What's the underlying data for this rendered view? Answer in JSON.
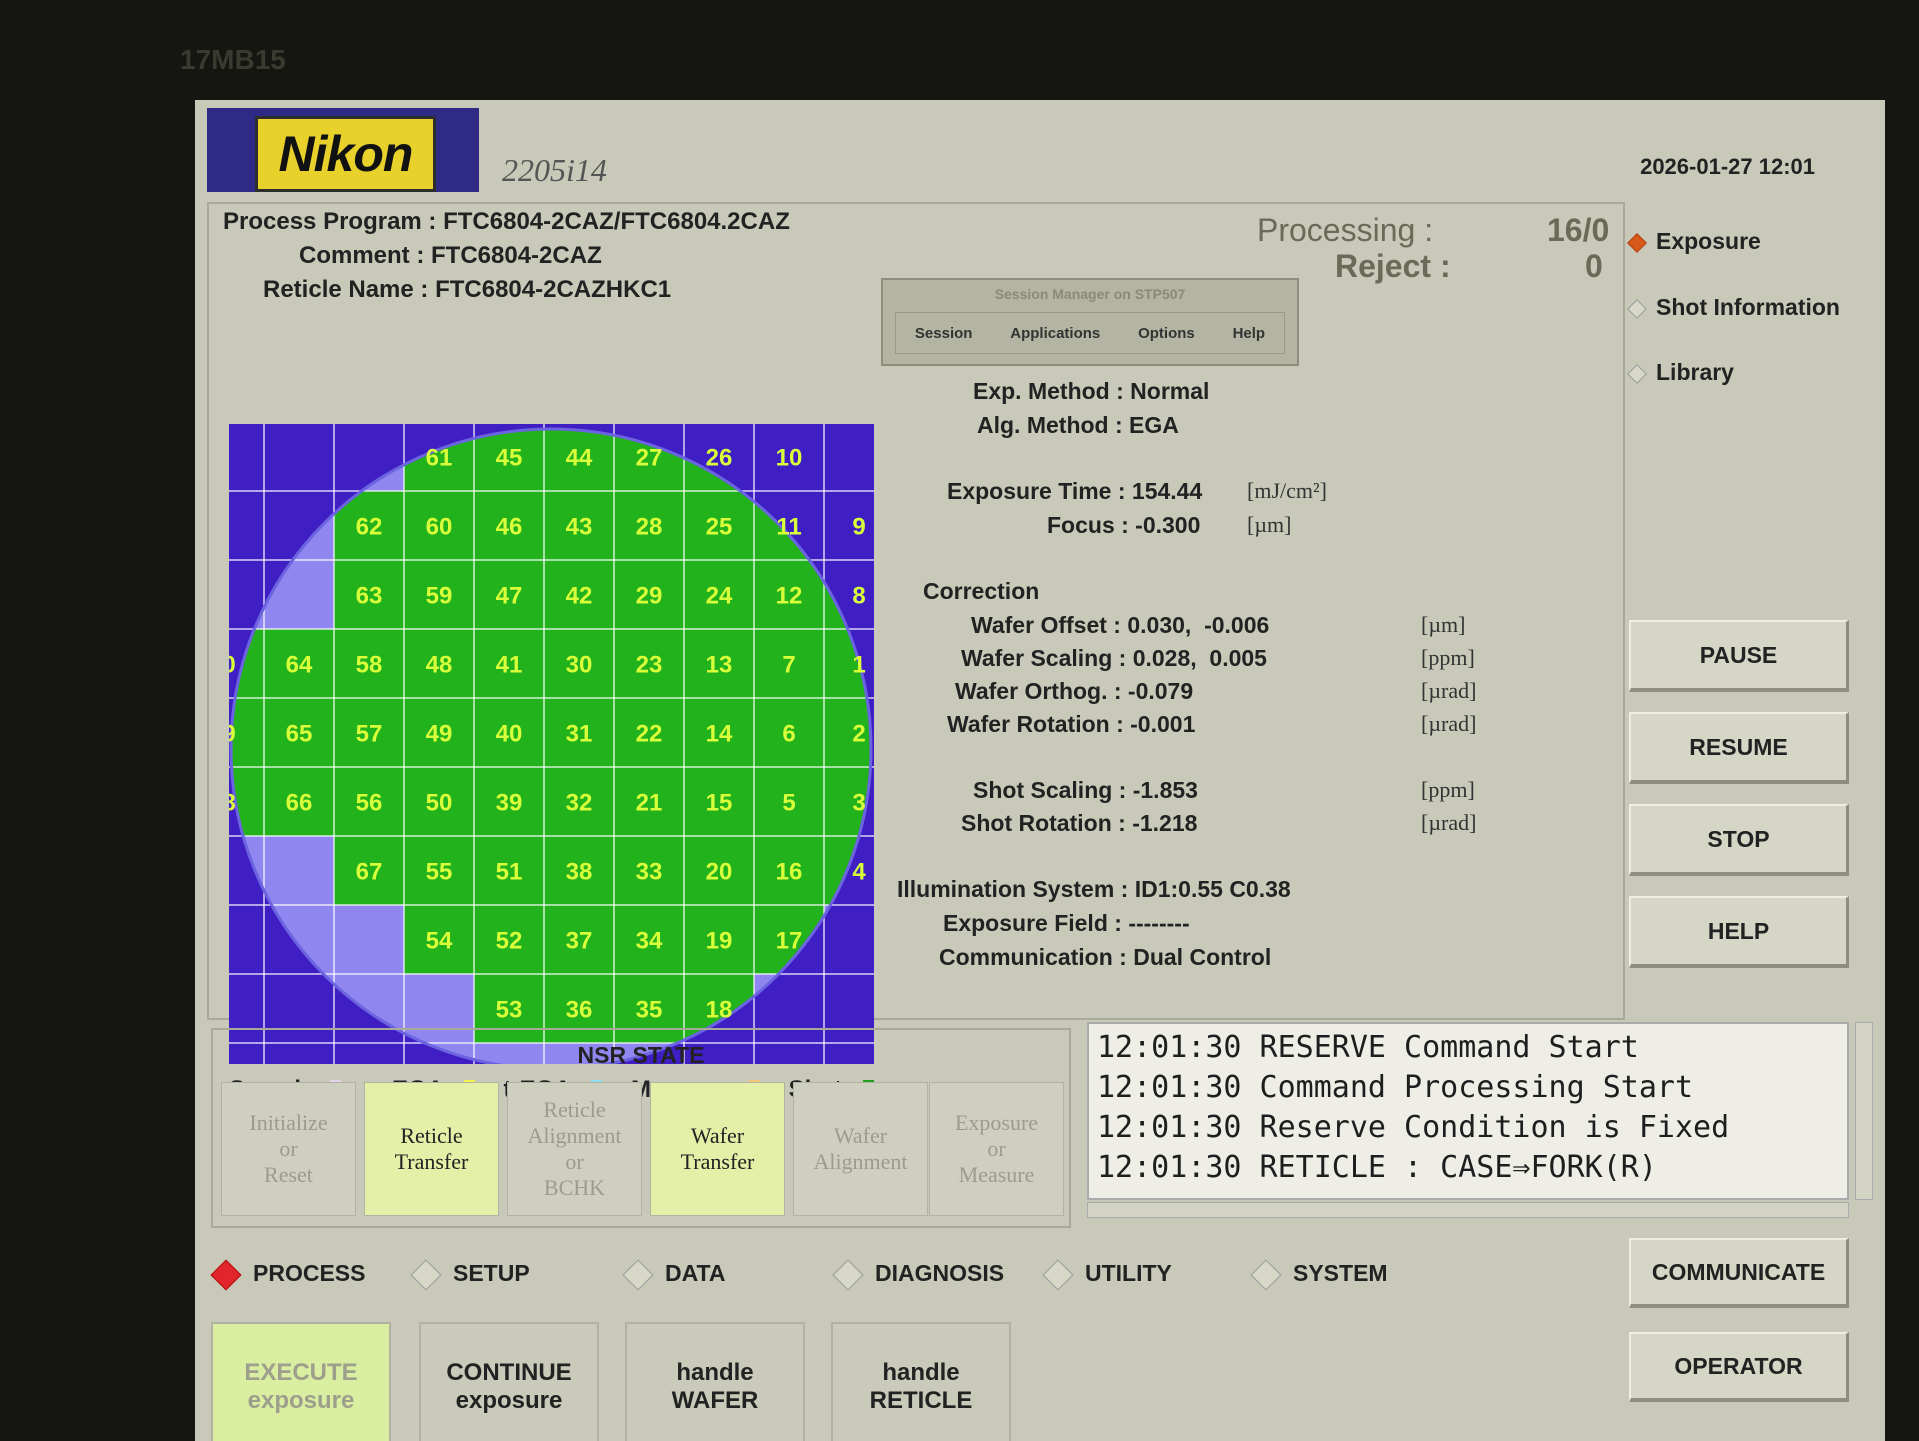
{
  "bezel_label": "17MB15",
  "header": {
    "logo": "Nikon",
    "model": "2205i14",
    "datetime": "2026-01-27 12:01"
  },
  "program": {
    "process_program_label": "Process Program :",
    "process_program": "FTC6804-2CAZ/FTC6804.2CAZ",
    "comment_label": "Comment :",
    "comment": "FTC6804-2CAZ",
    "reticle_label": "Reticle Name :",
    "reticle": "FTC6804-2CAZHKC1"
  },
  "status": {
    "processing_label": "Processing :",
    "processing_value": "16/0",
    "reject_label": "Reject :",
    "reject_value": "0"
  },
  "session_manager": {
    "title": "Session Manager on STP507",
    "menu": [
      "Session",
      "Applications",
      "Options",
      "Help"
    ]
  },
  "params": {
    "exp_method_label": "Exp. Method :",
    "exp_method": "Normal",
    "alg_method_label": "Alg. Method :",
    "alg_method": "EGA",
    "exposure_time_label": "Exposure Time :",
    "exposure_time": "154.44",
    "exposure_time_unit": "[mJ/cm²]",
    "focus_label": "Focus :",
    "focus": "-0.300",
    "focus_unit": "[µm]",
    "correction_label": "Correction",
    "wafer_offset_label": "Wafer Offset :",
    "wafer_offset": "0.030,  -0.006",
    "wafer_offset_unit": "[µm]",
    "wafer_scaling_label": "Wafer Scaling :",
    "wafer_scaling": "0.028,  0.005",
    "wafer_scaling_unit": "[ppm]",
    "wafer_orthog_label": "Wafer Orthog. :",
    "wafer_orthog": "-0.079",
    "wafer_orthog_unit": "[µrad]",
    "wafer_rotation_label": "Wafer Rotation :",
    "wafer_rotation": "-0.001",
    "wafer_rotation_unit": "[µrad]",
    "shot_scaling_label": "Shot Scaling :",
    "shot_scaling": "-1.853",
    "shot_scaling_unit": "[ppm]",
    "shot_rotation_label": "Shot Rotation :",
    "shot_rotation": "-1.218",
    "shot_rotation_unit": "[µrad]",
    "illumination_label": "Illumination System :",
    "illumination": "ID1:0.55 C0.38",
    "exposure_field_label": "Exposure Field :",
    "exposure_field": "--------",
    "communication_label": "Communication :",
    "communication": "Dual Control"
  },
  "right_menu": {
    "exposure": "Exposure",
    "shot_information": "Shot Information",
    "library": "Library"
  },
  "control_buttons": {
    "pause": "PAUSE",
    "resume": "RESUME",
    "stop": "STOP",
    "help": "HELP"
  },
  "legend": {
    "search": "Search :",
    "g_ega": "g-EGA :",
    "t_ega": "t-EGA :",
    "measure": "Measure :",
    "shot": "Shot :",
    "colors": {
      "search": "#e6d2ec",
      "g_ega": "#f1f24a",
      "t_ega": "#8fdff0",
      "measure": "#f0c878",
      "shot": "#1fa01f"
    }
  },
  "wafer_map": {
    "rows": [
      [
        null,
        null,
        61,
        45,
        44,
        27,
        26,
        10,
        null
      ],
      [
        null,
        62,
        60,
        46,
        43,
        28,
        25,
        11,
        9
      ],
      [
        null,
        63,
        59,
        47,
        42,
        29,
        24,
        12,
        8
      ],
      [
        "0",
        64,
        58,
        48,
        41,
        30,
        23,
        13,
        7,
        "1"
      ],
      [
        "9",
        65,
        57,
        49,
        40,
        31,
        22,
        14,
        6,
        "2"
      ],
      [
        "8",
        66,
        56,
        50,
        39,
        32,
        21,
        15,
        5,
        "3"
      ],
      [
        null,
        67,
        55,
        51,
        38,
        33,
        20,
        16,
        4
      ],
      [
        null,
        null,
        54,
        52,
        37,
        34,
        19,
        17,
        null
      ],
      [
        null,
        null,
        null,
        53,
        36,
        35,
        18,
        null,
        null
      ]
    ],
    "colors": {
      "background": "#3f1ec4",
      "wafer": "#8f86f0",
      "shot": "#22b21c",
      "grid": "#ffffff",
      "label": "#d8ff3a"
    }
  },
  "nsr_state": {
    "title": "NSR STATE",
    "items": [
      {
        "label": "Initialize\nor\nReset",
        "active": false
      },
      {
        "label": "Reticle\nTransfer",
        "active": true
      },
      {
        "label": "Reticle\nAlignment\nor\nBCHK",
        "active": false
      },
      {
        "label": "Wafer\nTransfer",
        "active": true
      },
      {
        "label": "Wafer\nAlignment",
        "active": false
      },
      {
        "label": "Exposure\nor\nMeasure",
        "active": false
      }
    ]
  },
  "log": [
    "12:01:30 RESERVE Command Start",
    "12:01:30 Command Processing Start",
    "12:01:30 Reserve Condition is Fixed",
    "12:01:30 RETICLE : CASE⇒FORK(R)"
  ],
  "modes": {
    "process": "PROCESS",
    "setup": "SETUP",
    "data": "DATA",
    "diagnosis": "DIAGNOSIS",
    "utility": "UTILITY",
    "system": "SYSTEM"
  },
  "side_buttons": {
    "communicate": "COMMUNICATE",
    "operator": "OPERATOR"
  },
  "commands": {
    "execute": "EXECUTE\nexposure",
    "continue": "CONTINUE\nexposure",
    "handle_wafer": "handle\nWAFER",
    "handle_reticle": "handle\nRETICLE"
  }
}
